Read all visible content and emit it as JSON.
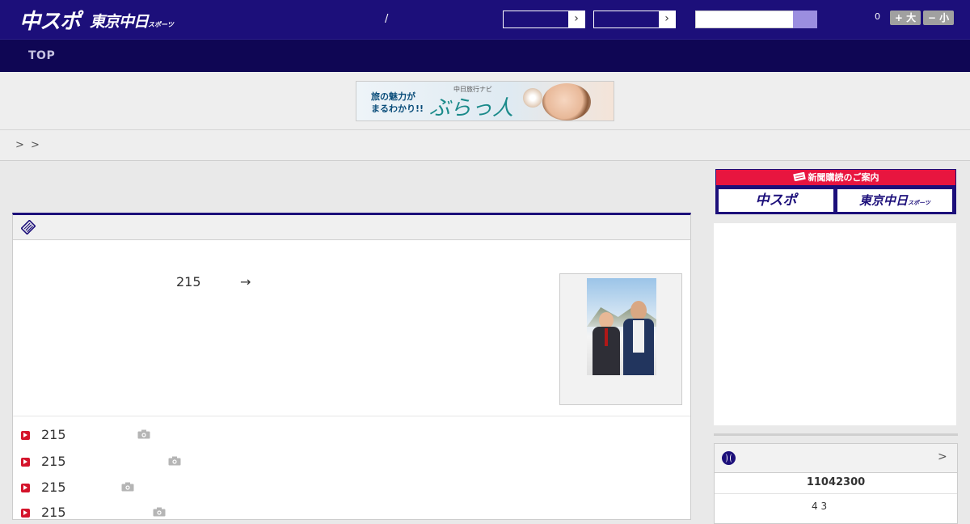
{
  "header": {
    "logo_main": "中スポ",
    "logo_sub": "東京中日",
    "logo_sub_small": "スポーツ",
    "date_separator": "/",
    "font_size_count": "0",
    "font_larger_label": "+ 大",
    "font_smaller_label": "− 小",
    "colors": {
      "header_bg": "#1c0f7a",
      "nav_bg": "#0f0654",
      "accent_red": "#e8153f",
      "search_button": "#9b8ee0"
    }
  },
  "nav": {
    "items": [
      {
        "label": "TOP"
      }
    ]
  },
  "ad_banner": {
    "line1": "旅の魅力が",
    "line2": "まるわかり!!",
    "small": "中日旅行ナビ",
    "brand": "ぶらっ人"
  },
  "breadcrumb": {
    "separators": [
      ">",
      ">"
    ]
  },
  "article": {
    "lead_number": "215",
    "lead_arrow": "→",
    "list": [
      {
        "text": "215",
        "icon": "camera-icon"
      },
      {
        "text": "215",
        "icon": "camera-icon"
      },
      {
        "text": "215",
        "icon": "camera-icon"
      },
      {
        "text": "215",
        "icon": "camera-icon"
      }
    ]
  },
  "sidebar": {
    "subscribe_heading": "新聞購読のご案内",
    "subscribe_chunichi": "中スポ",
    "subscribe_tokyo": "東京中日",
    "subscribe_tokyo_small": "スポーツ",
    "score": {
      "more": ">",
      "date": "11042300",
      "game": "4  3"
    }
  }
}
